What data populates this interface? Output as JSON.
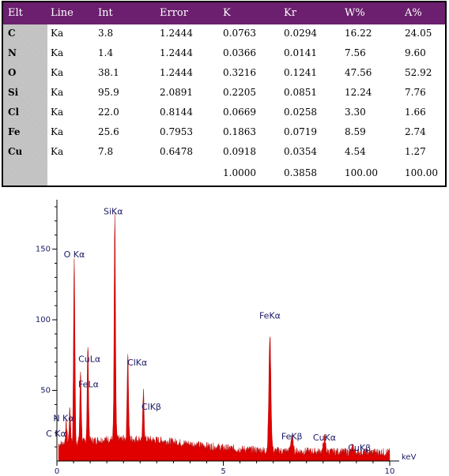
{
  "table": {
    "headers": [
      "Elt",
      "Line",
      "Int",
      "Error",
      "K",
      "Kr",
      "W%",
      "A%"
    ],
    "rows": [
      [
        "C",
        "Ka",
        "3.8",
        "1.2444",
        "0.0763",
        "0.0294",
        "16.22",
        "24.05"
      ],
      [
        "N",
        "Ka",
        "1.4",
        "1.2444",
        "0.0366",
        "0.0141",
        "7.56",
        "9.60"
      ],
      [
        "O",
        "Ka",
        "38.1",
        "1.2444",
        "0.3216",
        "0.1241",
        "47.56",
        "52.92"
      ],
      [
        "Si",
        "Ka",
        "95.9",
        "2.0891",
        "0.2205",
        "0.0851",
        "12.24",
        "7.76"
      ],
      [
        "Cl",
        "Ka",
        "22.0",
        "0.8144",
        "0.0669",
        "0.0258",
        "3.30",
        "1.66"
      ],
      [
        "Fe",
        "Ka",
        "25.6",
        "0.7953",
        "0.1863",
        "0.0719",
        "8.59",
        "2.74"
      ],
      [
        "Cu",
        "Ka",
        "7.8",
        "0.6478",
        "0.0918",
        "0.0354",
        "4.54",
        "1.27"
      ]
    ],
    "totals": [
      "",
      "",
      "",
      "",
      "1.0000",
      "0.3858",
      "100.00",
      "100.00"
    ],
    "header_color": "#6b1f6e"
  },
  "chart_data": {
    "type": "area",
    "xlabel": "keV",
    "xlim": [
      0,
      10
    ],
    "ylim": [
      0,
      185
    ],
    "x_ticks": [
      0,
      5,
      10
    ],
    "y_ticks": [
      50,
      100,
      150
    ],
    "fill_color": "#e00000",
    "peaks": [
      {
        "label": "C Kα",
        "x": 0.28,
        "y": 15
      },
      {
        "label": "N Kα",
        "x": 0.39,
        "y": 25
      },
      {
        "label": "O Kα",
        "x": 0.52,
        "y": 132
      },
      {
        "label": "FeLα",
        "x": 0.71,
        "y": 50
      },
      {
        "label": "CuLα",
        "x": 0.93,
        "y": 68
      },
      {
        "label": "SiKα",
        "x": 1.74,
        "y": 158
      },
      {
        "label": "ClKα",
        "x": 2.13,
        "y": 62
      },
      {
        "label": "ClKβ",
        "x": 2.6,
        "y": 33
      },
      {
        "label": "FeKα",
        "x": 6.4,
        "y": 82
      },
      {
        "label": "FeKβ",
        "x": 7.06,
        "y": 12
      },
      {
        "label": "CuKα",
        "x": 8.04,
        "y": 10
      },
      {
        "label": "CuKβ",
        "x": 8.9,
        "y": 4
      }
    ]
  }
}
